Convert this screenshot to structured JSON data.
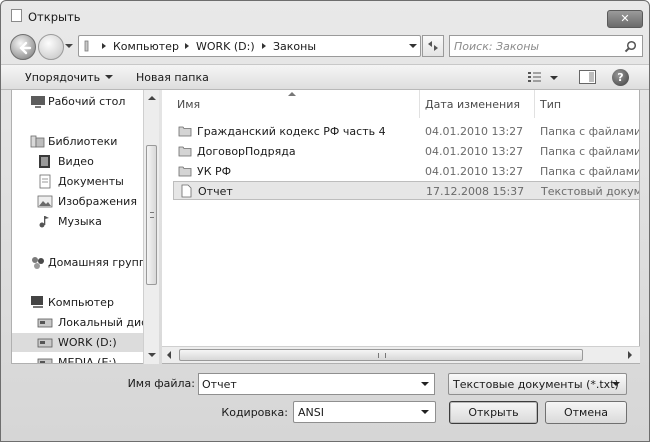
{
  "window": {
    "title": "Открыть"
  },
  "address": {
    "crumbs": [
      "Компьютер",
      "WORK (D:)",
      "Законы"
    ]
  },
  "search": {
    "placeholder": "Поиск: Законы"
  },
  "toolbar": {
    "organize": "Упорядочить",
    "new_folder": "Новая папка"
  },
  "nav": {
    "items": [
      {
        "label": "Рабочий стол",
        "icon": "desktop-icon"
      },
      {
        "label": "Библиотеки",
        "icon": "libraries-icon"
      },
      {
        "label": "Видео",
        "icon": "video-icon"
      },
      {
        "label": "Документы",
        "icon": "documents-icon"
      },
      {
        "label": "Изображения",
        "icon": "pictures-icon"
      },
      {
        "label": "Музыка",
        "icon": "music-icon"
      },
      {
        "label": "Домашняя группа",
        "icon": "homegroup-icon"
      },
      {
        "label": "Компьютер",
        "icon": "computer-icon"
      },
      {
        "label": "Локальный диск",
        "icon": "drive-icon"
      },
      {
        "label": "WORK (D:)",
        "icon": "drive-icon"
      },
      {
        "label": "MEDIA (E:)",
        "icon": "drive-icon"
      }
    ]
  },
  "files": {
    "columns": [
      "Имя",
      "Дата изменения",
      "Тип"
    ],
    "rows": [
      {
        "name": "Гражданский кодекс РФ часть 4",
        "date": "04.01.2010 13:27",
        "type": "Папка с файлами",
        "icon": "folder-icon"
      },
      {
        "name": "ДоговорПодряда",
        "date": "04.01.2010 13:27",
        "type": "Папка с файлами",
        "icon": "folder-icon"
      },
      {
        "name": "УК РФ",
        "date": "04.01.2010 13:27",
        "type": "Папка с файлами",
        "icon": "folder-icon"
      },
      {
        "name": "Отчет",
        "date": "17.12.2008 15:37",
        "type": "Текстовый докум...",
        "icon": "text-file-icon"
      }
    ]
  },
  "footer": {
    "filename_label": "Имя файла:",
    "filename_value": "Отчет",
    "filetype": "Текстовые документы (*.txt)",
    "encoding_label": "Кодировка:",
    "encoding_value": "ANSI",
    "open": "Открыть",
    "cancel": "Отмена"
  }
}
